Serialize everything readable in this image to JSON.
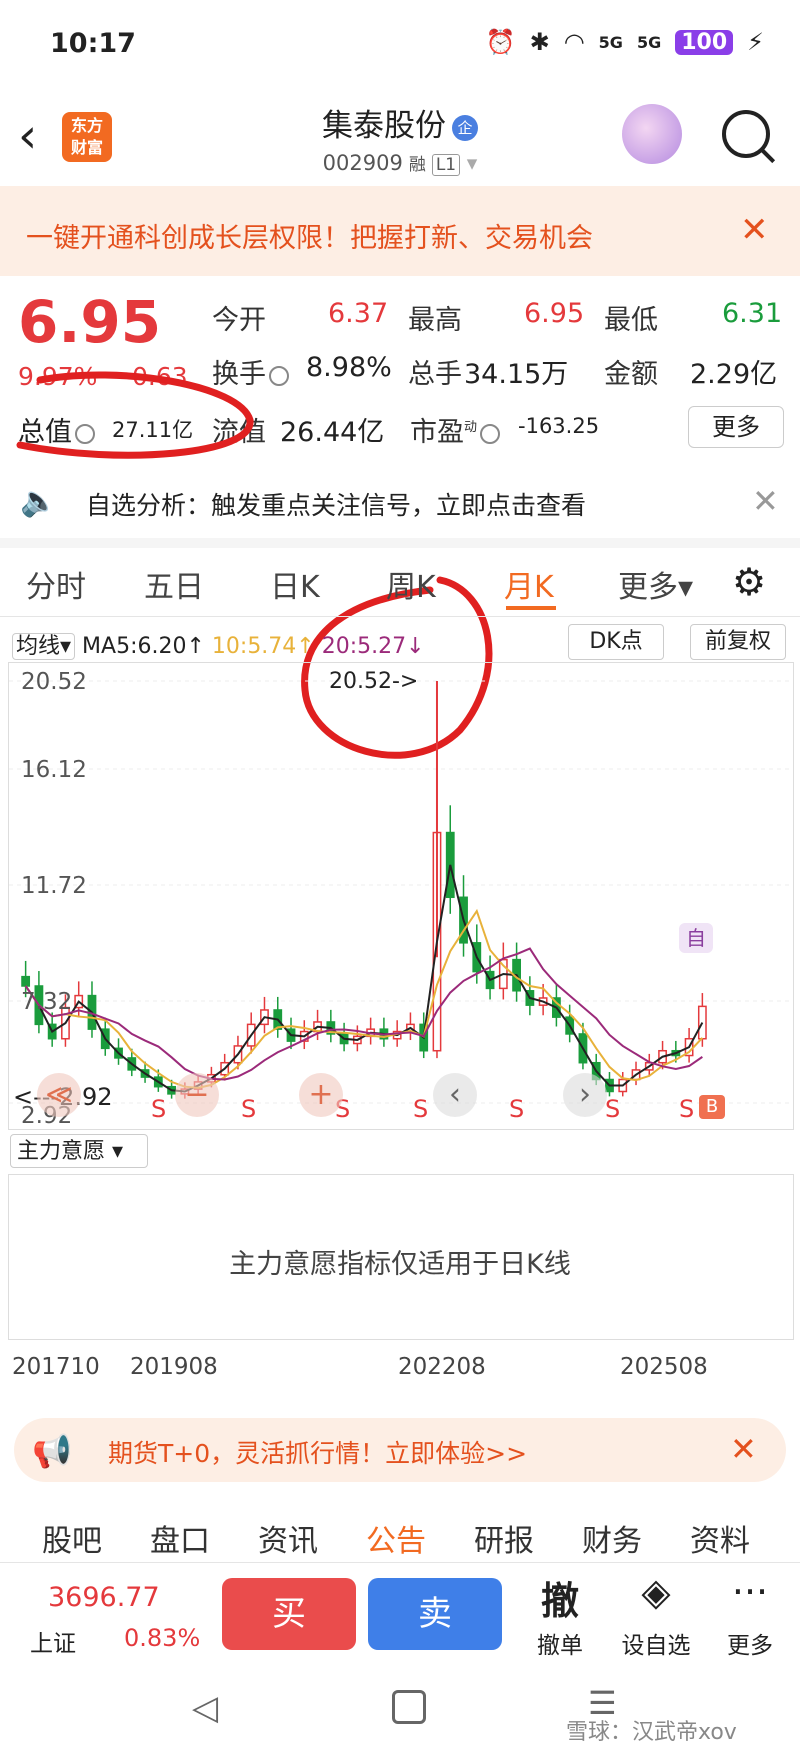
{
  "status_bar": {
    "time": "10:17",
    "signal_5g_a": "5G",
    "signal_5g_b": "5G",
    "battery": "100"
  },
  "header": {
    "name": "集泰股份",
    "qi_badge": "企",
    "code": "002909",
    "tag_rong": "融",
    "tag_l1": "L1",
    "logo_line1": "东方",
    "logo_line2": "财富"
  },
  "banner": {
    "text": "一键开通科创成长层权限！把握打新、交易机会"
  },
  "quote": {
    "price": "6.95",
    "pct": "9.97%",
    "change": "0.63",
    "open_label": "今开",
    "open": "6.37",
    "high_label": "最高",
    "high": "6.95",
    "low_label": "最低",
    "low": "6.31",
    "turnover_label": "换手",
    "turnover": "8.98%",
    "volume_label": "总手",
    "volume": "34.15万",
    "amount_label": "金额",
    "amount": "2.29亿",
    "total_value_label": "总值",
    "total_value": "27.11亿",
    "float_value_label": "流值",
    "float_value": "26.44亿",
    "pe_label": "市盈",
    "pe_sup": "动",
    "pe": "-163.25",
    "more": "更多"
  },
  "alert": {
    "text": "自选分析：触发重点关注信号，立即点击查看"
  },
  "kline_tabs": [
    "分时",
    "五日",
    "日K",
    "周K",
    "月K",
    "更多▾"
  ],
  "ma": {
    "select": "均线▾",
    "ma5": "MA5:6.20↑",
    "ma10": "10:5.74↑",
    "ma20": "20:5.27↓",
    "dk": "DK点",
    "fq": "前复权"
  },
  "chart_data": {
    "type": "candlestick",
    "y_ticks": [
      "20.52",
      "16.12",
      "11.72",
      "7.32",
      "2.92"
    ],
    "ylim": [
      2.92,
      20.52
    ],
    "x_ticks": [
      "201710",
      "201908",
      "202208",
      "202508"
    ],
    "max_label": "20.52->",
    "min_label": "<---2.92",
    "markers": [
      "S",
      "S",
      "S",
      "S",
      "S",
      "S",
      "S",
      "B",
      "自"
    ],
    "closes": [
      7.8,
      6.2,
      5.6,
      6.9,
      7.4,
      6.0,
      5.2,
      4.8,
      4.3,
      4.0,
      3.6,
      3.3,
      3.5,
      3.8,
      4.1,
      4.6,
      5.3,
      6.2,
      6.8,
      6.0,
      5.5,
      5.9,
      6.3,
      5.8,
      5.4,
      5.7,
      6.0,
      5.6,
      5.9,
      6.2,
      5.1,
      14.2,
      11.5,
      9.6,
      8.4,
      7.7,
      8.9,
      7.6,
      7.0,
      7.3,
      6.5,
      5.8,
      4.6,
      3.9,
      3.4,
      3.9,
      4.3,
      4.6,
      5.1,
      4.9,
      5.6,
      6.95
    ],
    "ma_series": [
      "MA5",
      "MA10",
      "MA20"
    ]
  },
  "nav_arrows": {
    "first": "≪",
    "zoom_out": "−",
    "zoom_in": "+",
    "prev": "‹",
    "next": "›"
  },
  "indicator": {
    "select": "主力意愿 ▾",
    "message": "主力意愿指标仅适用于日K线"
  },
  "ad": {
    "text": "期货T+0，灵活抓行情！立即体验>>"
  },
  "bottom_tabs": [
    "股吧",
    "盘口",
    "资讯",
    "公告",
    "研报",
    "财务",
    "资料"
  ],
  "trade_bar": {
    "index_value": "3696.77",
    "index_name": "上证",
    "index_pct": "0.83%",
    "buy": "买",
    "sell": "卖",
    "cancel_icon": "撤",
    "cancel": "撤单",
    "fav": "设自选",
    "more": "更多"
  },
  "watermark": "雪球：汉武帝xov",
  "colors": {
    "up": "#e4393c",
    "down": "#1a9c3c",
    "accent": "#f26a21",
    "ma5": "#222222",
    "ma10": "#e8b23a",
    "ma20": "#9b2a7a"
  }
}
